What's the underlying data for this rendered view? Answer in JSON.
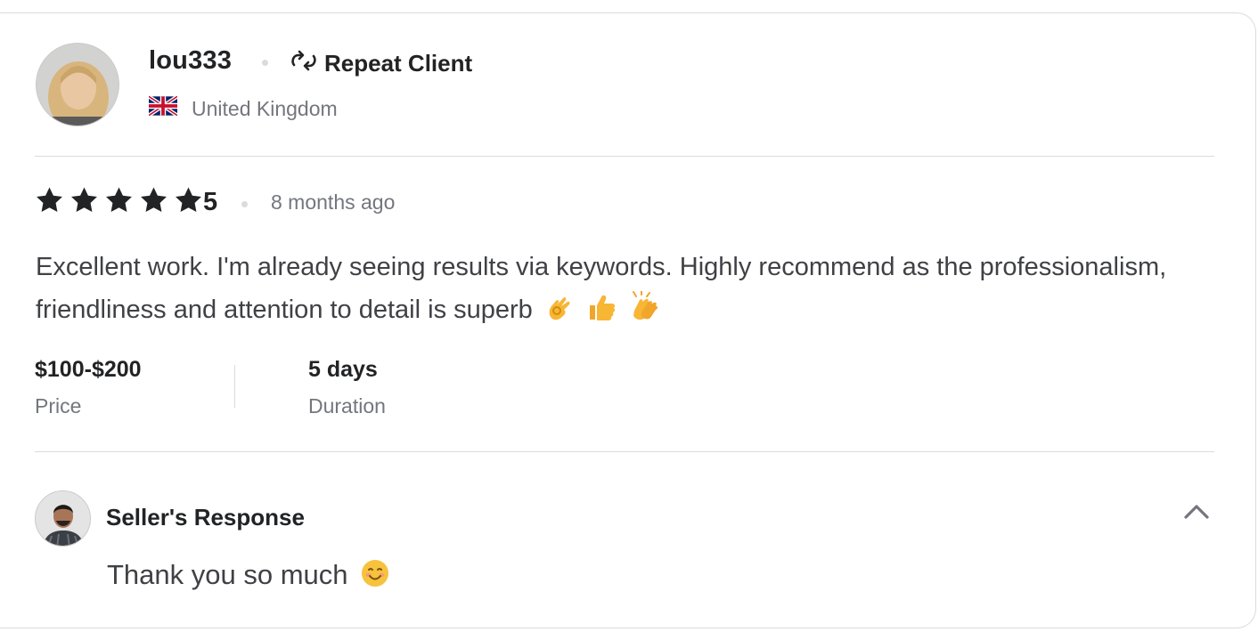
{
  "reviewer": {
    "username": "lou333",
    "badge_label": "Repeat Client",
    "badge_icon": "repeat-icon",
    "country": "United Kingdom",
    "flag_icon": "uk-flag-icon"
  },
  "review": {
    "stars": 5,
    "rating": "5",
    "time_ago": "8 months ago",
    "text": "Excellent work. I'm already seeing results via keywords. Highly recommend as the professionalism, friendliness and attention to detail is superb",
    "emojis": [
      "ok-hand-emoji",
      "thumbs-up-emoji",
      "clapping-hands-emoji"
    ]
  },
  "meta": {
    "price_value": "$100-$200",
    "price_label": "Price",
    "duration_value": "5 days",
    "duration_label": "Duration"
  },
  "seller_response": {
    "title": "Seller's Response",
    "text": "Thank you so much",
    "emoji": "smiling-face-emoji",
    "toggle_icon": "chevron-up-icon"
  },
  "colors": {
    "text_dark": "#222325",
    "text_body": "#404145",
    "text_muted": "#74767e",
    "divider": "#dadbdd"
  }
}
